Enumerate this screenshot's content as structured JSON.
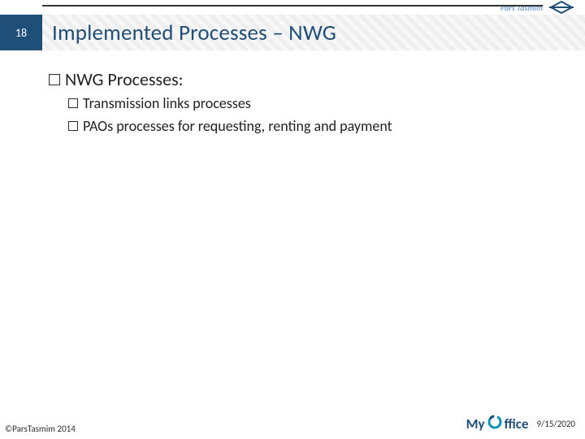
{
  "page_number": "18",
  "title": "Implemented Processes – NWG",
  "brand": {
    "text": "Pars Tasmim"
  },
  "content": {
    "heading": "NWG Processes:",
    "items": [
      "Transmission links processes",
      "PAOs processes for requesting, renting and payment"
    ]
  },
  "footer": {
    "copyright": "©ParsTasmim 2014",
    "product": {
      "prefix": "My",
      "suffix": "ffice"
    },
    "date": "9/15/2020"
  }
}
